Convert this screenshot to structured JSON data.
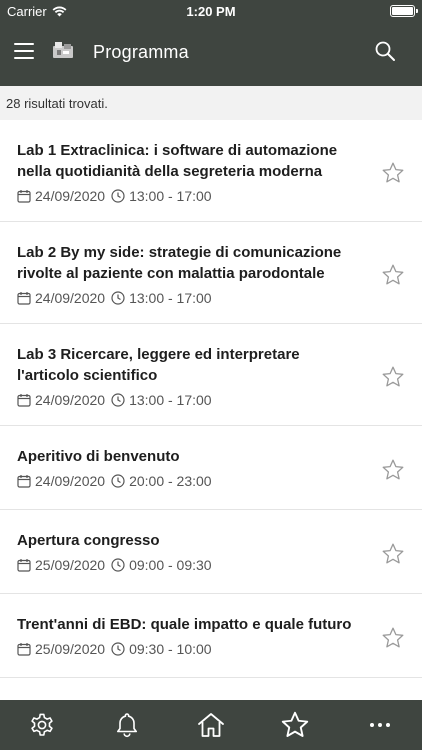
{
  "status_bar": {
    "carrier": "Carrier",
    "time": "1:20 PM"
  },
  "app_bar": {
    "title": "Programma"
  },
  "results": {
    "count_text": "28 risultati trovati."
  },
  "events": [
    {
      "title": "Lab 1 Extraclinica: i software di automazione nella quotidianità della segreteria moderna",
      "date": "24/09/2020",
      "time": "13:00 - 17:00"
    },
    {
      "title": "Lab 2 By my side: strategie di comunicazione rivolte al paziente con malattia parodontale",
      "date": "24/09/2020",
      "time": "13:00 - 17:00"
    },
    {
      "title": "Lab 3 Ricercare, leggere ed interpretare l'articolo scientifico",
      "date": "24/09/2020",
      "time": "13:00 - 17:00"
    },
    {
      "title": "Aperitivo di benvenuto",
      "date": "24/09/2020",
      "time": "20:00 - 23:00"
    },
    {
      "title": "Apertura congresso",
      "date": "25/09/2020",
      "time": "09:00 - 09:30"
    },
    {
      "title": "Trent'anni di EBD: quale impatto e quale futuro",
      "date": "25/09/2020",
      "time": "09:30 - 10:00"
    }
  ],
  "bottom_nav": [
    "gear-icon",
    "bell-icon",
    "home-icon",
    "star-icon",
    "more-icon"
  ],
  "colors": {
    "bar": "#3f4540",
    "list_bg": "#ffffff",
    "page_bg": "#f2f2f2"
  }
}
